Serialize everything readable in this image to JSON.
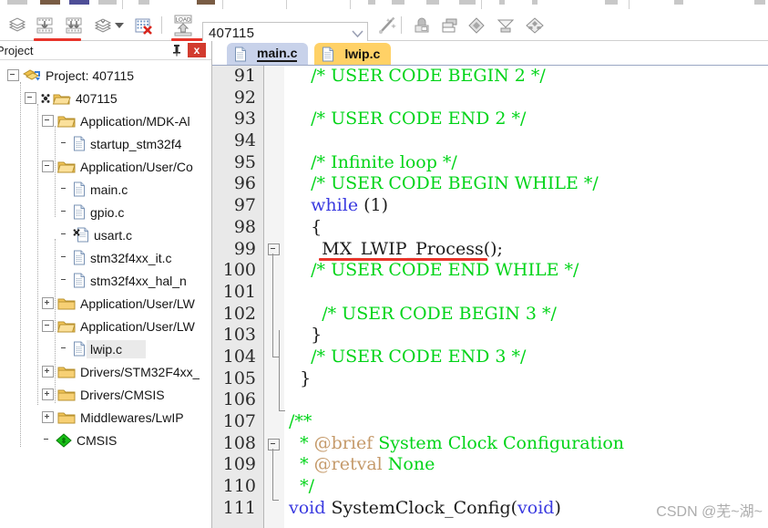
{
  "window": {
    "app": "Keil uVision MDK"
  },
  "menu_strip": {
    "note": "clipped menu/toolbar row at very top of capture"
  },
  "toolbar": {
    "buttons": [
      {
        "name": "translate-icon",
        "title": "Translate"
      },
      {
        "name": "build-icon",
        "title": "Build"
      },
      {
        "name": "rebuild-icon",
        "title": "Rebuild"
      },
      {
        "name": "batch-build-icon",
        "title": "Batch Build"
      },
      {
        "name": "stop-build-icon",
        "title": "Stop Build"
      },
      {
        "name": "download-icon",
        "title": "Download"
      }
    ],
    "download_label": "LOAD",
    "right_buttons": [
      {
        "name": "magic-wand-icon",
        "title": "Configuration Wizard"
      },
      {
        "name": "target-options-icon",
        "title": "Options for Target"
      },
      {
        "name": "manage-project-icon",
        "title": "Manage Project Items"
      },
      {
        "name": "components-icon",
        "title": "Manage Run-Time Environment"
      },
      {
        "name": "pack-installer-icon",
        "title": "Pack Installer"
      },
      {
        "name": "multi-project-icon",
        "title": "Multi-Project"
      }
    ],
    "target_combo": {
      "value": "407115",
      "placeholder": "407115"
    },
    "annotation_color": "#e8342a"
  },
  "project_panel": {
    "title": "Project",
    "pin_icon": "pin-icon",
    "close_icon": "close-icon",
    "close_label": "x",
    "tree": [
      {
        "label": "Project: 407115",
        "depth": 0,
        "icon": "project-icon",
        "expander": "minus",
        "selected": false
      },
      {
        "label": "407115",
        "depth": 1,
        "icon": "target-icon",
        "expander": "minus",
        "selected": false
      },
      {
        "label": "Application/MDK-Al",
        "depth": 2,
        "icon": "folder-open-icon",
        "expander": "minus",
        "selected": false
      },
      {
        "label": "startup_stm32f4",
        "depth": 3,
        "icon": "file-icon",
        "expander": "none",
        "selected": false
      },
      {
        "label": "Application/User/Co",
        "depth": 2,
        "icon": "folder-open-icon",
        "expander": "minus",
        "selected": false
      },
      {
        "label": "main.c",
        "depth": 3,
        "icon": "file-icon",
        "expander": "none",
        "selected": false
      },
      {
        "label": "gpio.c",
        "depth": 3,
        "icon": "file-icon",
        "expander": "none",
        "selected": false
      },
      {
        "label": "usart.c",
        "depth": 3,
        "icon": "file-compiled-icon",
        "expander": "none",
        "selected": false
      },
      {
        "label": "stm32f4xx_it.c",
        "depth": 3,
        "icon": "file-icon",
        "expander": "none",
        "selected": false
      },
      {
        "label": "stm32f4xx_hal_n",
        "depth": 3,
        "icon": "file-icon",
        "expander": "none",
        "selected": false
      },
      {
        "label": "Application/User/LW",
        "depth": 2,
        "icon": "folder-icon",
        "expander": "plus",
        "selected": false
      },
      {
        "label": "Application/User/LW",
        "depth": 2,
        "icon": "folder-open-icon",
        "expander": "minus",
        "selected": false
      },
      {
        "label": "lwip.c",
        "depth": 3,
        "icon": "file-icon",
        "expander": "none",
        "selected": true
      },
      {
        "label": "Drivers/STM32F4xx_",
        "depth": 2,
        "icon": "folder-icon",
        "expander": "plus",
        "selected": false
      },
      {
        "label": "Drivers/CMSIS",
        "depth": 2,
        "icon": "folder-icon",
        "expander": "plus",
        "selected": false
      },
      {
        "label": "Middlewares/LwIP",
        "depth": 2,
        "icon": "folder-icon",
        "expander": "plus",
        "selected": false
      },
      {
        "label": "CMSIS",
        "depth": 2,
        "icon": "cmsis-icon",
        "expander": "none",
        "selected": false
      }
    ]
  },
  "editor": {
    "tabs": [
      {
        "label": "main.c",
        "active": true,
        "icon": "file-icon"
      },
      {
        "label": "lwip.c",
        "active": false,
        "icon": "file-icon"
      }
    ],
    "first_line_number": 91,
    "lines": [
      {
        "n": 91,
        "segments": [
          {
            "t": "    /* USER CODE BEGIN 2 */",
            "c": "cmt"
          }
        ]
      },
      {
        "n": 92,
        "segments": [
          {
            "t": "",
            "c": "plain"
          }
        ]
      },
      {
        "n": 93,
        "segments": [
          {
            "t": "    /* USER CODE END 2 */",
            "c": "cmt"
          }
        ]
      },
      {
        "n": 94,
        "segments": [
          {
            "t": "",
            "c": "plain"
          }
        ]
      },
      {
        "n": 95,
        "segments": [
          {
            "t": "    /* Infinite loop */",
            "c": "cmt"
          }
        ]
      },
      {
        "n": 96,
        "segments": [
          {
            "t": "    /* USER CODE BEGIN WHILE */",
            "c": "cmt"
          }
        ]
      },
      {
        "n": 97,
        "segments": [
          {
            "t": "    ",
            "c": "plain"
          },
          {
            "t": "while",
            "c": "kw"
          },
          {
            "t": " (1)",
            "c": "plain"
          }
        ]
      },
      {
        "n": 98,
        "segments": [
          {
            "t": "    {",
            "c": "plain"
          }
        ]
      },
      {
        "n": 99,
        "segments": [
          {
            "t": "      MX_LWIP_Process();",
            "c": "plain"
          }
        ]
      },
      {
        "n": 100,
        "segments": [
          {
            "t": "    /* USER CODE END WHILE */",
            "c": "cmt"
          }
        ]
      },
      {
        "n": 101,
        "segments": [
          {
            "t": "",
            "c": "plain"
          }
        ]
      },
      {
        "n": 102,
        "segments": [
          {
            "t": "      /* USER CODE BEGIN 3 */",
            "c": "cmt"
          }
        ]
      },
      {
        "n": 103,
        "segments": [
          {
            "t": "    }",
            "c": "plain"
          }
        ]
      },
      {
        "n": 104,
        "segments": [
          {
            "t": "    /* USER CODE END 3 */",
            "c": "cmt"
          }
        ]
      },
      {
        "n": 105,
        "segments": [
          {
            "t": "  }",
            "c": "plain"
          }
        ]
      },
      {
        "n": 106,
        "segments": [
          {
            "t": "",
            "c": "plain"
          }
        ]
      },
      {
        "n": 107,
        "segments": [
          {
            "t": "/**",
            "c": "cmt"
          }
        ]
      },
      {
        "n": 108,
        "segments": [
          {
            "t": "  * ",
            "c": "cmt"
          },
          {
            "t": "@brief",
            "c": "doc"
          },
          {
            "t": " System Clock Configuration",
            "c": "cmt"
          }
        ]
      },
      {
        "n": 109,
        "segments": [
          {
            "t": "  * ",
            "c": "cmt"
          },
          {
            "t": "@retval",
            "c": "doc"
          },
          {
            "t": " None",
            "c": "cmt"
          }
        ]
      },
      {
        "n": 110,
        "segments": [
          {
            "t": "  */",
            "c": "cmt"
          }
        ]
      },
      {
        "n": 111,
        "segments": [
          {
            "t": "",
            "c": "plain"
          },
          {
            "t": "void",
            "c": "kw"
          },
          {
            "t": " SystemClock_Config(",
            "c": "plain"
          },
          {
            "t": "void",
            "c": "kw"
          },
          {
            "t": ")",
            "c": "plain"
          }
        ]
      }
    ],
    "annotation": {
      "underlined_line": 99,
      "underlined_text": "MX_LWIP_Process();",
      "color": "#e8342a"
    },
    "syntax_colors": {
      "comment": "#00d418",
      "keyword": "#3a3ae0",
      "doc_tag": "#c59a6a",
      "plain": "#1c1c1c",
      "background": "#ffffff",
      "gutter": "#e9e9e9"
    }
  },
  "watermark": {
    "text": "CSDN @芜~湖~"
  }
}
